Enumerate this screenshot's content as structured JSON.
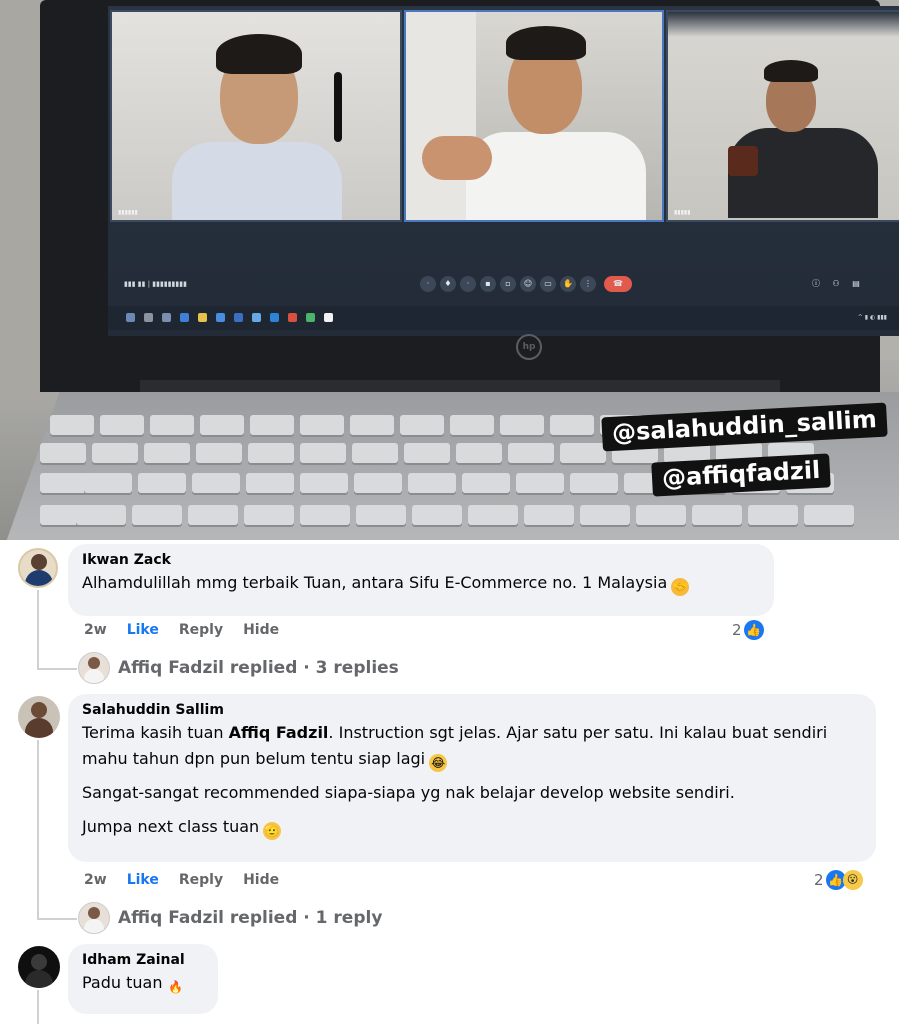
{
  "photo": {
    "watermarks": [
      "@salahuddin_sallim",
      "@affiqfadzil"
    ],
    "laptop_brand": "hp"
  },
  "comments": [
    {
      "author": "Ikwan Zack",
      "text": "Alhamdulillah mmg terbaik Tuan, antara Sifu E-Commerce no. 1 Malaysia",
      "emoji": "handshake-emoji",
      "time": "2w",
      "like": "Like",
      "reply": "Reply",
      "hide": "Hide",
      "reaction_count": "2",
      "reactions": [
        "like"
      ],
      "replies_author": "Affiq Fadzil replied",
      "replies_count": "· 3 replies"
    },
    {
      "author": "Salahuddin Sallim",
      "text_before_mention": "Terima kasih tuan ",
      "mention": "Affiq Fadzil",
      "text_after_mention": ". Instruction sgt jelas. Ajar satu per satu. Ini kalau buat sendiri mahu tahun dpn pun belum tentu siap lagi",
      "text_p2": "Sangat-sangat recommended siapa-siapa yg nak belajar develop website sendiri.",
      "text_p3": "Jumpa next class tuan",
      "time": "2w",
      "like": "Like",
      "reply": "Reply",
      "hide": "Hide",
      "reaction_count": "2",
      "reactions": [
        "like",
        "wow"
      ],
      "replies_author": "Affiq Fadzil replied",
      "replies_count": "· 1 reply"
    },
    {
      "author": "Idham Zainal",
      "text": "Padu tuan",
      "emoji": "fire-emoji"
    }
  ],
  "colors": {
    "link_blue": "#1877f2",
    "bubble_bg": "#f0f2f5",
    "muted_text": "#65676b"
  }
}
